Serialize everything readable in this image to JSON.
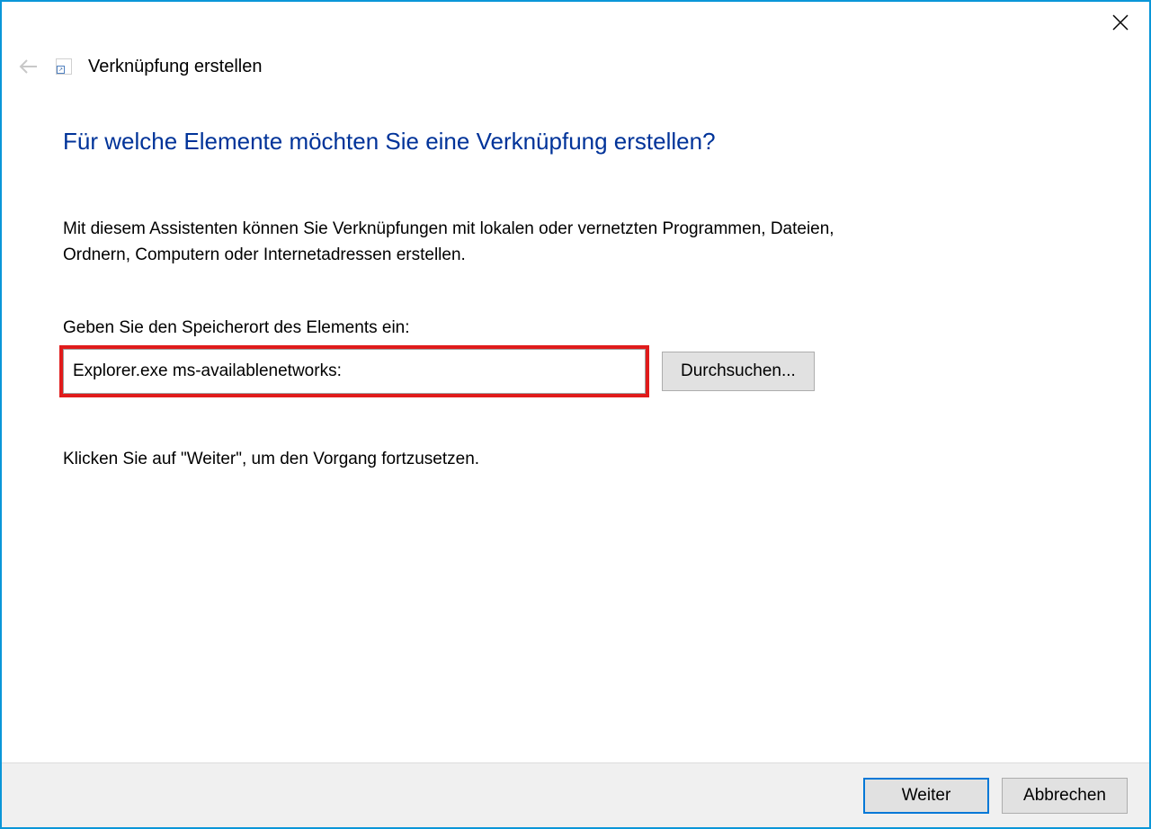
{
  "window": {
    "wizard_title": "Verknüpfung erstellen"
  },
  "content": {
    "heading": "Für welche Elemente möchten Sie eine Verknüpfung erstellen?",
    "description": "Mit diesem Assistenten können Sie Verknüpfungen mit lokalen oder vernetzten Programmen, Dateien, Ordnern, Computern oder Internetadressen erstellen.",
    "input_label": "Geben Sie den Speicherort des Elements ein:",
    "input_value": "Explorer.exe ms-availablenetworks:",
    "browse_label": "Durchsuchen...",
    "continue_hint": "Klicken Sie auf \"Weiter\", um den Vorgang fortzusetzen."
  },
  "footer": {
    "next_label": "Weiter",
    "cancel_label": "Abbrechen"
  }
}
